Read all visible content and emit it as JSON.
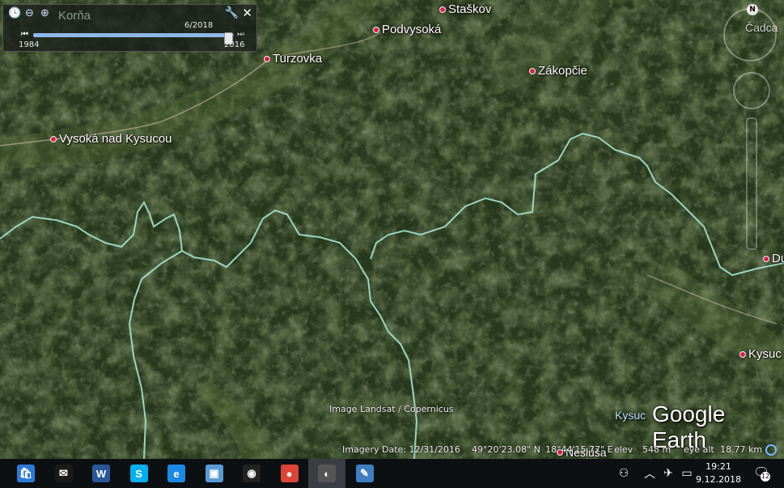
{
  "app": {
    "name": "Google Earth"
  },
  "time_slider": {
    "layer_label": "Korňa",
    "selected_date": "6/2018",
    "start_year": "1984",
    "end_year": "2016",
    "position_fraction": 0.97
  },
  "places": [
    {
      "name": "Staškov",
      "id": "place-staskov"
    },
    {
      "name": "Podvysoká",
      "id": "place-podvysoka"
    },
    {
      "name": "Turzovka",
      "id": "place-turzovka"
    },
    {
      "name": "Zákopčie",
      "id": "place-zakopcie"
    },
    {
      "name": "Vysoká nad Kysucou",
      "id": "place-vysoka-nad-kysucou"
    },
    {
      "name": "Čadca",
      "id": "place-cadca"
    },
    {
      "name": "Du",
      "id": "place-du"
    },
    {
      "name": "Kysuc",
      "id": "place-kysuc"
    },
    {
      "name": "Kysuc",
      "id": "place-kysuc-bottom"
    },
    {
      "name": "Nesluša",
      "id": "place-neslusa"
    }
  ],
  "attribution": "Image Landsat / Copernicus",
  "logo": "Google Earth",
  "status": {
    "imagery_date": "Imagery Date: 12/31/2016",
    "lat": "49°20'23.08\" N",
    "lon": "18°44'15.77\" E",
    "elev_label": "elev",
    "elev_value": "548 m",
    "eye_alt_label": "eye alt",
    "eye_alt_value": "18.77 km"
  },
  "compass_label": "N",
  "taskbar": {
    "apps": [
      {
        "id": "store",
        "icon": "store-icon",
        "glyph": "🛍",
        "color": "#2b7bd6"
      },
      {
        "id": "mail",
        "icon": "mail-icon",
        "glyph": "✉",
        "color": "#1a1a1a"
      },
      {
        "id": "word",
        "icon": "word-icon",
        "glyph": "W",
        "color": "#2b5797"
      },
      {
        "id": "skype",
        "icon": "skype-icon",
        "glyph": "S",
        "color": "#00aff0"
      },
      {
        "id": "edge-like",
        "icon": "browser-icon",
        "glyph": "e",
        "color": "#1e88e5"
      },
      {
        "id": "photos",
        "icon": "photos-icon",
        "glyph": "▣",
        "color": "#5b9bd5"
      },
      {
        "id": "media",
        "icon": "media-player-icon",
        "glyph": "◉",
        "color": "#222222"
      },
      {
        "id": "chrome",
        "icon": "chrome-icon",
        "glyph": "●",
        "color": "#db4437"
      },
      {
        "id": "earth",
        "icon": "google-earth-icon",
        "glyph": "◐",
        "color": "#555555"
      },
      {
        "id": "paint",
        "icon": "paint-icon",
        "glyph": "✎",
        "color": "#3f7fbf"
      }
    ],
    "tray": {
      "people_icon": "people-icon",
      "chevron_icon": "chevron-up-icon",
      "airplane_icon": "airplane-mode-icon",
      "battery_icon": "battery-icon",
      "time": "19:21",
      "date": "9.12.2018",
      "notifications_count": "12"
    }
  }
}
